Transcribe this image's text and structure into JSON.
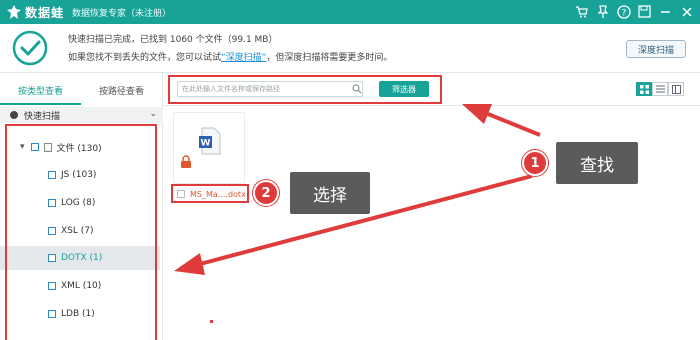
{
  "app": {
    "name": "数据蛙",
    "subtitle": "数据恢复专家（未注册）"
  },
  "title_icons": [
    "cart-icon",
    "pin-icon",
    "help-icon",
    "save-icon",
    "minimize-icon",
    "close-icon"
  ],
  "status": {
    "line1": "快速扫描已完成，已找到 1060 个文件（99.1 MB）",
    "line2_before": "如果您找不到丢失的文件，您可以试试",
    "line2_link": "“深度扫描”",
    "line2_after": "，但深度扫描将需要更多时间。",
    "deep_scan_button": "深度扫描"
  },
  "sidebar": {
    "tabs": [
      "按类型查看",
      "按路径查看"
    ],
    "active_tab": 0,
    "quick_scan": "快速扫描",
    "tree": [
      {
        "label": "文件 (130)",
        "level": 0,
        "expanded": true
      },
      {
        "label": "JS (103)",
        "level": 1
      },
      {
        "label": "LOG (8)",
        "level": 1
      },
      {
        "label": "XSL (7)",
        "level": 1
      },
      {
        "label": "DOTX (1)",
        "level": 1,
        "selected": true
      },
      {
        "label": "XML (10)",
        "level": 1
      },
      {
        "label": "LDB (1)",
        "level": 1
      }
    ]
  },
  "toolbar": {
    "search_placeholder": "在此处输入文件名称或保存路径",
    "filter_button": "筛选器",
    "views": [
      "grid-view-icon",
      "list-view-icon",
      "detail-view-icon"
    ],
    "active_view": 0
  },
  "files": [
    {
      "name": "MS_Ma....dotx",
      "icon": "word-document-icon"
    }
  ],
  "annotations": {
    "callout1_number": "1",
    "callout1_text": "查找",
    "callout2_number": "2",
    "callout2_text": "选择"
  },
  "colors": {
    "accent": "#17a398",
    "annotation_red": "#e03b3b",
    "callout_bg": "#5b5b5b"
  }
}
